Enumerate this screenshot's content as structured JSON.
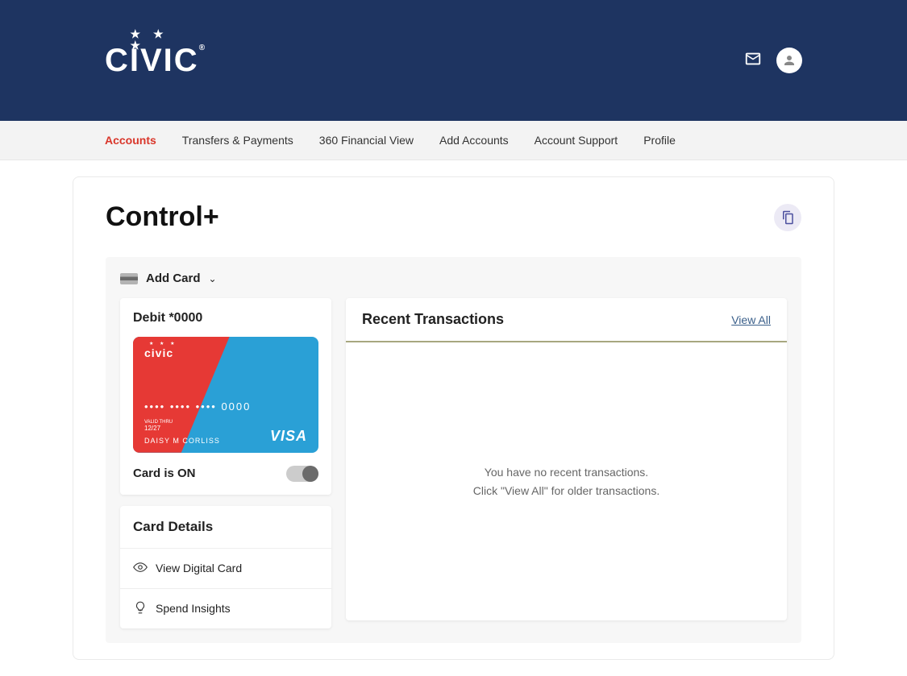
{
  "brand": "CIVIC",
  "nav": {
    "items": [
      {
        "label": "Accounts",
        "active": true
      },
      {
        "label": "Transfers & Payments",
        "active": false
      },
      {
        "label": "360 Financial View",
        "active": false
      },
      {
        "label": "Add Accounts",
        "active": false
      },
      {
        "label": "Account Support",
        "active": false
      },
      {
        "label": "Profile",
        "active": false
      }
    ]
  },
  "page": {
    "title": "Control+",
    "add_card_label": "Add Card"
  },
  "card": {
    "label": "Debit *0000",
    "brand": "civic",
    "number": "•••• •••• •••• 0000",
    "valid_label": "VALID THRU",
    "valid_thru": "12/27",
    "holder": "DAISY M CORLISS",
    "network": "VISA",
    "status_label": "Card is ON"
  },
  "details": {
    "title": "Card Details",
    "items": [
      {
        "label": "View Digital Card",
        "icon": "eye"
      },
      {
        "label": "Spend Insights",
        "icon": "bulb"
      }
    ]
  },
  "transactions": {
    "title": "Recent Transactions",
    "view_all": "View All",
    "empty_line1": "You have no recent transactions.",
    "empty_line2": "Click \"View All\" for older transactions."
  }
}
